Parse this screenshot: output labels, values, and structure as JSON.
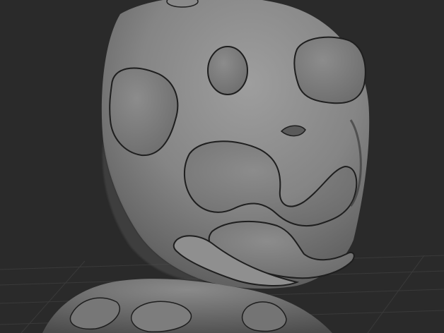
{
  "app": {
    "view": "3d-viewport",
    "theme": {
      "background": "#2a2a2a",
      "grid_line": "#3a3a3a",
      "model_base": "#7b7b7b",
      "model_highlight": "#a2a2a2",
      "model_shadow": "#4a4a4a",
      "groove_line": "#1e1e1e"
    }
  },
  "viewport": {
    "grid_visible": true,
    "model": {
      "kind": "sculpt-head-bust",
      "material": "clay-grey",
      "features": [
        "left-cheek-plate",
        "right-forehead-plate",
        "forehead-oval",
        "top-nub",
        "center-face-plate",
        "eye-slit",
        "lower-jaw-plate",
        "chin-ridge",
        "neck-plates"
      ]
    }
  }
}
